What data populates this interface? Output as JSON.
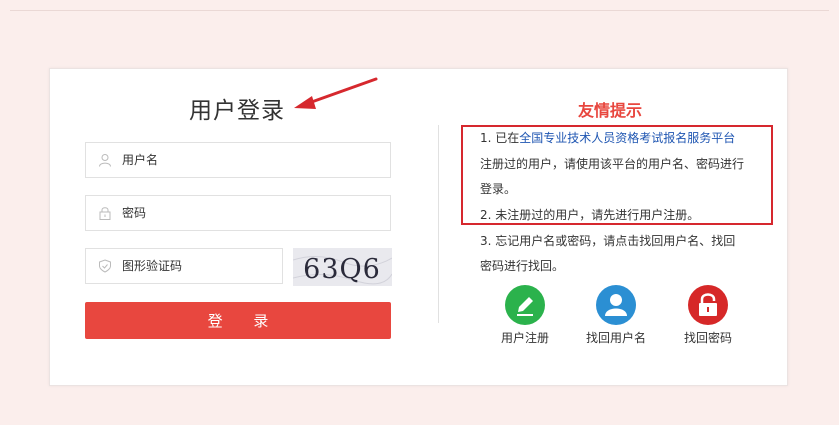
{
  "login": {
    "title": "用户登录",
    "username_placeholder": "用户名",
    "password_placeholder": "密码",
    "captcha_placeholder": "图形验证码",
    "captcha_text": "63Q6",
    "submit_label": "登 录"
  },
  "tips": {
    "title": "友情提示",
    "line1_prefix": "1. 已在",
    "line1_link": "全国专业技术人员资格考试报名服务平台",
    "line1_cont": "注册过的用户，请使用该平台的用户名、密码进行",
    "line1_end": "登录。",
    "line2": "2. 未注册过的用户，请先进行用户注册。",
    "line3": "3. 忘记用户名或密码，请点击找回用户名、找回",
    "line3_cont": "密码进行找回。"
  },
  "quick_links": [
    {
      "label": "用户注册",
      "icon": "pencil-icon",
      "color": "#2bb24c"
    },
    {
      "label": "找回用户名",
      "icon": "user-icon",
      "color": "#2b8fd3"
    },
    {
      "label": "找回密码",
      "icon": "lock-icon",
      "color": "#d62828"
    }
  ],
  "colors": {
    "accent": "#e8473f",
    "highlight_box": "#d6282e",
    "link": "#1f56b2",
    "background": "#fbeeec"
  }
}
